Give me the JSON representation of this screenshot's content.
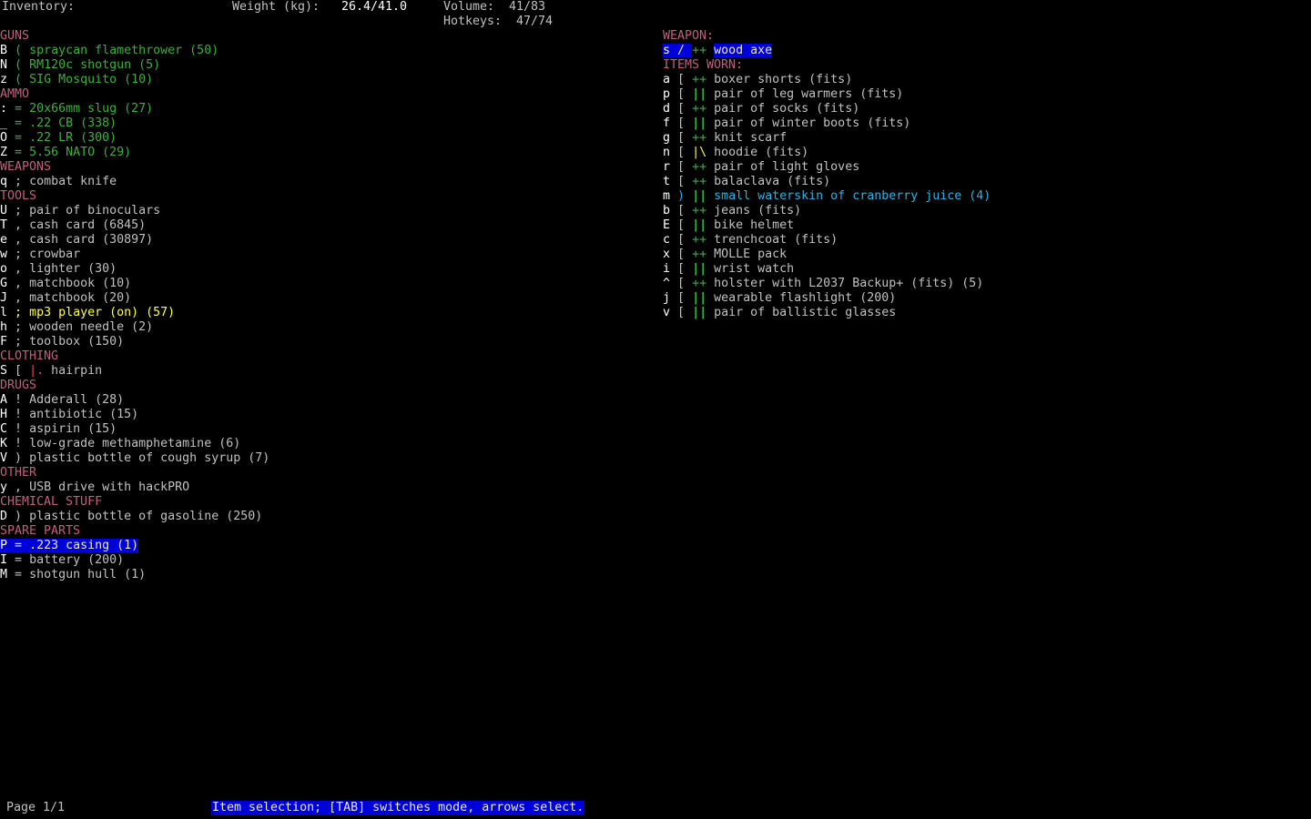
{
  "header": {
    "inventory_label": "Inventory:",
    "weight_label": "Weight (kg):",
    "weight_value": "26.4/41.0",
    "volume_label": "Volume:",
    "volume_value": "41/83",
    "hotkeys_label": "Hotkeys:",
    "hotkeys_value": "47/74"
  },
  "left_list": [
    {
      "type": "header",
      "text": "GUNS"
    },
    {
      "type": "item",
      "key": "B",
      "sym": "(",
      "name": "spraycan flamethrower (50)",
      "color": "green"
    },
    {
      "type": "item",
      "key": "N",
      "sym": "(",
      "name": "RM120c shotgun (5)",
      "color": "green"
    },
    {
      "type": "item",
      "key": "z",
      "sym": "(",
      "name": "SIG Mosquito (10)",
      "color": "green"
    },
    {
      "type": "header",
      "text": "AMMO"
    },
    {
      "type": "item",
      "key": ":",
      "sym": "=",
      "name": "20x66mm slug (27)",
      "color": "green"
    },
    {
      "type": "item",
      "key": "_",
      "sym": "=",
      "name": ".22 CB (338)",
      "color": "green"
    },
    {
      "type": "item",
      "key": "O",
      "sym": "=",
      "name": ".22 LR (300)",
      "color": "green"
    },
    {
      "type": "item",
      "key": "Z",
      "sym": "=",
      "name": "5.56 NATO (29)",
      "color": "green"
    },
    {
      "type": "header",
      "text": "WEAPONS"
    },
    {
      "type": "item",
      "key": "q",
      "sym": ";",
      "name": "combat knife",
      "color": "gray"
    },
    {
      "type": "header",
      "text": "TOOLS"
    },
    {
      "type": "item",
      "key": "U",
      "sym": ";",
      "name": "pair of binoculars",
      "color": "gray"
    },
    {
      "type": "item",
      "key": "T",
      "sym": ",",
      "name": "cash card (6845)",
      "color": "gray"
    },
    {
      "type": "item",
      "key": "e",
      "sym": ",",
      "name": "cash card (30897)",
      "color": "gray"
    },
    {
      "type": "item",
      "key": "w",
      "sym": ";",
      "name": "crowbar",
      "color": "gray"
    },
    {
      "type": "item",
      "key": "o",
      "sym": ",",
      "name": "lighter (30)",
      "color": "gray"
    },
    {
      "type": "item",
      "key": "G",
      "sym": ",",
      "name": "matchbook (10)",
      "color": "gray"
    },
    {
      "type": "item",
      "key": "J",
      "sym": ",",
      "name": "matchbook (20)",
      "color": "gray"
    },
    {
      "type": "item",
      "key": "l",
      "sym": ";",
      "name": "mp3 player (on) (57)",
      "color": "yellow"
    },
    {
      "type": "item",
      "key": "h",
      "sym": ";",
      "name": "wooden needle (2)",
      "color": "gray"
    },
    {
      "type": "item",
      "key": "F",
      "sym": ";",
      "name": "toolbox (150)",
      "color": "gray"
    },
    {
      "type": "header",
      "text": "CLOTHING"
    },
    {
      "type": "item",
      "key": "S",
      "sym": "[",
      "mark": "|.",
      "name": "hairpin",
      "color": "gray"
    },
    {
      "type": "header",
      "text": "DRUGS"
    },
    {
      "type": "item",
      "key": "A",
      "sym": "!",
      "name": "Adderall (28)",
      "color": "gray"
    },
    {
      "type": "item",
      "key": "H",
      "sym": "!",
      "name": "antibiotic (15)",
      "color": "gray"
    },
    {
      "type": "item",
      "key": "C",
      "sym": "!",
      "name": "aspirin (15)",
      "color": "gray"
    },
    {
      "type": "item",
      "key": "K",
      "sym": "!",
      "name": "low-grade methamphetamine (6)",
      "color": "gray"
    },
    {
      "type": "item",
      "key": "V",
      "sym": ")",
      "name": "plastic bottle of cough syrup (7)",
      "color": "gray"
    },
    {
      "type": "header",
      "text": "OTHER"
    },
    {
      "type": "item",
      "key": "y",
      "sym": ",",
      "name": "USB drive with hackPRO",
      "color": "gray"
    },
    {
      "type": "header",
      "text": "CHEMICAL STUFF"
    },
    {
      "type": "item",
      "key": "D",
      "sym": ")",
      "name": "plastic bottle of gasoline (250)",
      "color": "gray"
    },
    {
      "type": "header",
      "text": "SPARE PARTS"
    },
    {
      "type": "item",
      "key": "P",
      "sym": "=",
      "name": ".223 casing (1)",
      "color": "gray",
      "selected": true
    },
    {
      "type": "item",
      "key": "I",
      "sym": "=",
      "name": "battery (200)",
      "color": "gray"
    },
    {
      "type": "item",
      "key": "M",
      "sym": "=",
      "name": "shotgun hull (1)",
      "color": "gray"
    }
  ],
  "right_list": [
    {
      "type": "header",
      "text": "WEAPON:"
    },
    {
      "type": "item",
      "key": "s",
      "sym": "/",
      "mark": "++",
      "name": "wood axe",
      "color": "gray",
      "selected": true
    },
    {
      "type": "header",
      "text": "ITEMS WORN:"
    },
    {
      "type": "item",
      "key": "a",
      "sym": "[",
      "mark": "++",
      "name": "boxer shorts (fits)",
      "color": "gray"
    },
    {
      "type": "item",
      "key": "p",
      "sym": "[",
      "mark": "||",
      "name": "pair of leg warmers (fits)",
      "color": "gray"
    },
    {
      "type": "item",
      "key": "d",
      "sym": "[",
      "mark": "++",
      "name": "pair of socks (fits)",
      "color": "gray"
    },
    {
      "type": "item",
      "key": "f",
      "sym": "[",
      "mark": "||",
      "name": "pair of winter boots (fits)",
      "color": "gray"
    },
    {
      "type": "item",
      "key": "g",
      "sym": "[",
      "mark": "++",
      "name": "knit scarf",
      "color": "gray"
    },
    {
      "type": "item",
      "key": "n",
      "sym": "[",
      "mark": "|\\",
      "name": "hoodie (fits)",
      "color": "gray"
    },
    {
      "type": "item",
      "key": "r",
      "sym": "[",
      "mark": "++",
      "name": "pair of light gloves",
      "color": "gray"
    },
    {
      "type": "item",
      "key": "t",
      "sym": "[",
      "mark": "++",
      "name": "balaclava (fits)",
      "color": "gray"
    },
    {
      "type": "item",
      "key": "m",
      "sym": ")",
      "mark": "||",
      "name": "small waterskin of cranberry juice (4)",
      "color": "cyan"
    },
    {
      "type": "item",
      "key": "b",
      "sym": "[",
      "mark": "++",
      "name": "jeans (fits)",
      "color": "gray"
    },
    {
      "type": "item",
      "key": "E",
      "sym": "[",
      "mark": "||",
      "name": "bike helmet",
      "color": "gray"
    },
    {
      "type": "item",
      "key": "c",
      "sym": "[",
      "mark": "++",
      "name": "trenchcoat (fits)",
      "color": "gray"
    },
    {
      "type": "item",
      "key": "x",
      "sym": "[",
      "mark": "++",
      "name": "MOLLE pack",
      "color": "gray"
    },
    {
      "type": "item",
      "key": "i",
      "sym": "[",
      "mark": "||",
      "name": "wrist watch",
      "color": "gray"
    },
    {
      "type": "item",
      "key": "^",
      "sym": "[",
      "mark": "++",
      "name": "holster with L2037 Backup+ (fits) (5)",
      "color": "gray"
    },
    {
      "type": "item",
      "key": "j",
      "sym": "[",
      "mark": "||",
      "name": "wearable flashlight (200)",
      "color": "gray"
    },
    {
      "type": "item",
      "key": "v",
      "sym": "[",
      "mark": "||",
      "name": "pair of ballistic glasses",
      "color": "gray"
    }
  ],
  "footer": {
    "page": "Page 1/1",
    "status": "Item selection; [TAB] switches mode, arrows select."
  },
  "colors": {
    "header": "#c06080",
    "selection_bg": "#0000d8",
    "green_item": "#3fae3f",
    "bright_green_mark": "#40ff40",
    "yellow_mark": "#ffff40",
    "highlight_item": "#ffff40",
    "cyan_item": "#30b0e0"
  }
}
